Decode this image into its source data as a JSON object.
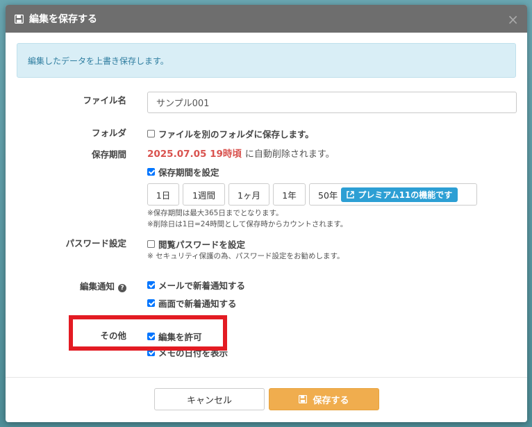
{
  "modal": {
    "title": "編集を保存する",
    "close": "×"
  },
  "alert": {
    "text": "編集したデータを上書き保存します。"
  },
  "file_name": {
    "label": "ファイル名",
    "value": "サンプル001"
  },
  "folder": {
    "label": "フォルダ",
    "option": "ファイルを別のフォルダに保存します。",
    "checked": false
  },
  "retention": {
    "label": "保存期間",
    "date": "2025.07.05 19時頃",
    "date_suffix": "に自動削除されます。",
    "set_label": "保存期間を設定",
    "set_checked": true,
    "options": [
      "1日",
      "1週間",
      "1ヶ月",
      "1年",
      "50年"
    ],
    "premium": "プレミアム11の機能です",
    "note1": "※保存期間は最大365日までとなります。",
    "note2": "※削除日は1日=24時間として保存時からカウントされます。"
  },
  "password": {
    "label": "パスワード設定",
    "option": "閲覧パスワードを設定",
    "checked": false,
    "note": "※ セキュリティ保護の為、パスワード設定をお勧めします。"
  },
  "notify": {
    "label": "編集通知",
    "help": "?",
    "mail": "メールで新着通知する",
    "screen": "画面で新着通知する"
  },
  "other": {
    "label": "その他",
    "allow_edit": "編集を許可",
    "partial_text": "メモの日付を表示"
  },
  "footer": {
    "cancel": "キャンセル",
    "save": "保存する"
  },
  "colors": {
    "highlight": "#e31b23",
    "save": "#f0ad4e",
    "premium": "#2d9fd4",
    "date": "#d9534f"
  }
}
